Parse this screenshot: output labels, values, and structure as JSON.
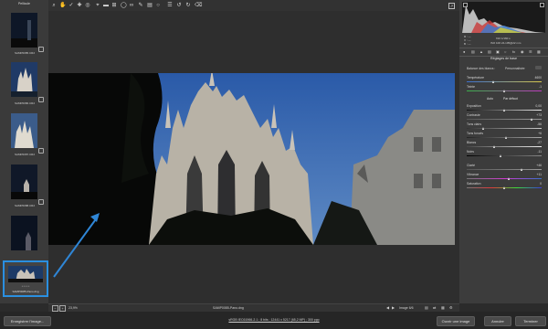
{
  "filmstrip": {
    "title": "Pellicule",
    "items": [
      {
        "label": "SAMP0085.CR2"
      },
      {
        "label": "SAMP0086.CR2"
      },
      {
        "label": "SAMP0087.CR2"
      },
      {
        "label": "SAMP0088.CR2"
      },
      {
        "label": ""
      },
      {
        "label": "SAMP0085-Pano.dng",
        "rating": "• • • • •"
      }
    ]
  },
  "histogram": {
    "r": "R : ---",
    "g": "V : ---",
    "b": "B : ---",
    "exif1": "f/16   1/160 s",
    "exif2": "ISO 100   24-105@22 mm"
  },
  "panel": {
    "title": "Réglages de base",
    "wb_label": "Balance des blancs :",
    "wb_value": "Personnalisée",
    "auto": "Auto",
    "default": "Par défaut",
    "sliders": [
      {
        "label": "Température",
        "value": "4600"
      },
      {
        "label": "Teinte",
        "value": "-1"
      },
      {
        "label": "Exposition",
        "value": "0,00"
      },
      {
        "label": "Contraste",
        "value": "+73"
      },
      {
        "label": "Tons clairs",
        "value": "-56"
      },
      {
        "label": "Tons foncés",
        "value": "+6"
      },
      {
        "label": "Blancs",
        "value": "-27"
      },
      {
        "label": "Noirs",
        "value": "-11"
      },
      {
        "label": "Clarté",
        "value": "+46"
      },
      {
        "label": "Vibrance",
        "value": "+11"
      },
      {
        "label": "Saturation",
        "value": "0"
      }
    ]
  },
  "bottom": {
    "zoom": "23,9%",
    "filename": "SAMP0085-Pano.dng",
    "image_count": "Image 6/6",
    "info": "sRGB IEC61966-2.1 ; 8 bits ; 12441 x 5217 (65,2 MP) ; 300 ppp",
    "save_label": "Enregistrer l'image...",
    "open_label": "Ouvrir une image",
    "cancel_label": "Annuler",
    "done_label": "Terminer"
  }
}
